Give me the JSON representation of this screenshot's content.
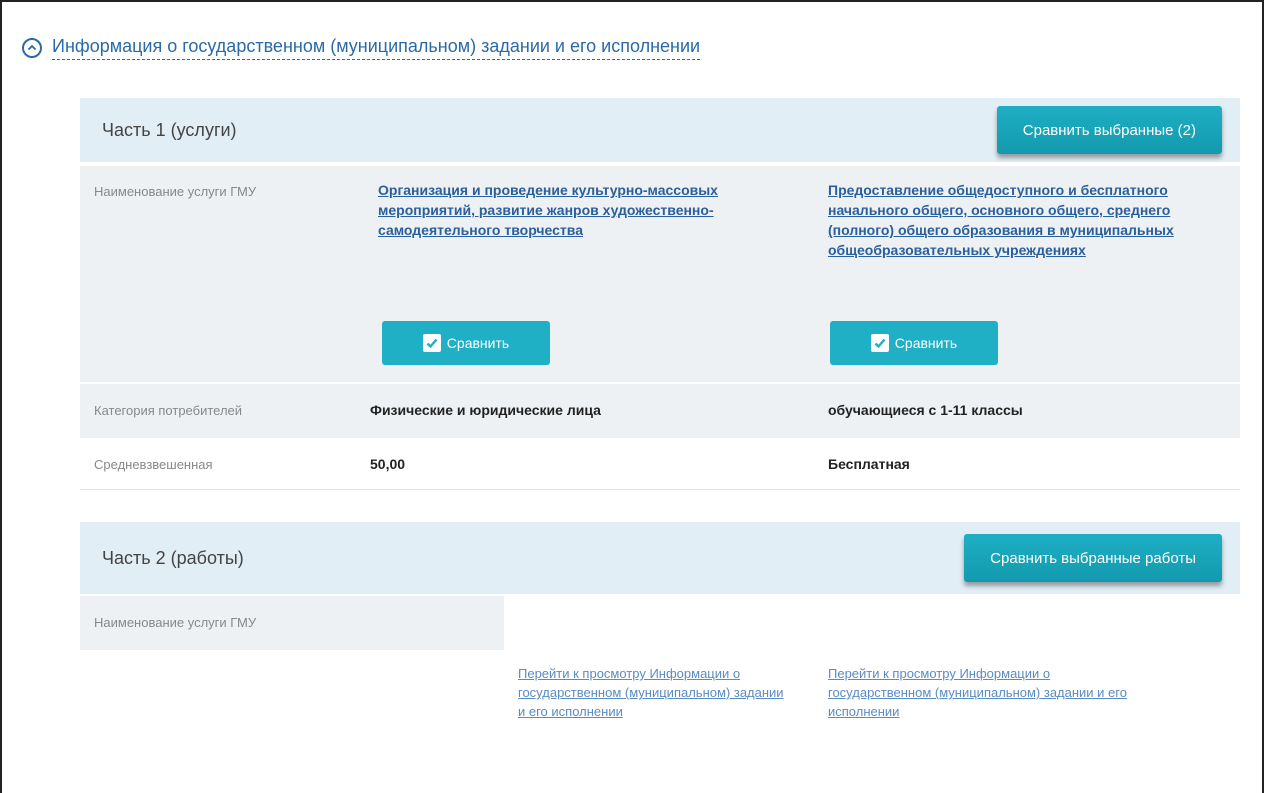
{
  "section": {
    "title": "Информация о государственном (муниципальном) задании и его исполнении",
    "collapse_icon": "collapse-circle-up-icon"
  },
  "part1": {
    "title": "Часть 1 (услуги)",
    "compare_selected_label": "Сравнить выбранные (2)",
    "rows": {
      "service_name_label": "Наименование услуги ГМУ",
      "consumer_category_label": "Категория потребителей",
      "weighted_avg_label": "Средневзвешенная"
    },
    "services": [
      {
        "name": "Организация и проведение культурно-массовых мероприятий, развитие жанров художественно-самодеятельного творчества",
        "compare_label": "Сравнить",
        "consumer_category": "Физические и юридические лица",
        "weighted_avg": "50,00"
      },
      {
        "name": "Предоставление общедоступного и бесплатного начального общего, основного общего, среднего (полного) общего образования в муниципальных общеобразовательных учреждениях",
        "compare_label": "Сравнить",
        "consumer_category": "обучающиеся с 1-11 классы",
        "weighted_avg": "Бесплатная"
      }
    ]
  },
  "part2": {
    "title": "Часть 2 (работы)",
    "compare_selected_label": "Сравнить выбранные работы",
    "service_name_label": "Наименование услуги ГМУ",
    "links": [
      "Перейти к просмотру Информации о государственном (муниципальном) задании и его исполнении",
      "Перейти к просмотру Информации о государственном (муниципальном) задании и его исполнении"
    ]
  },
  "colors": {
    "accent": "#1fb0c6",
    "link": "#2a5f9e",
    "header_bg": "#e2eef5"
  }
}
